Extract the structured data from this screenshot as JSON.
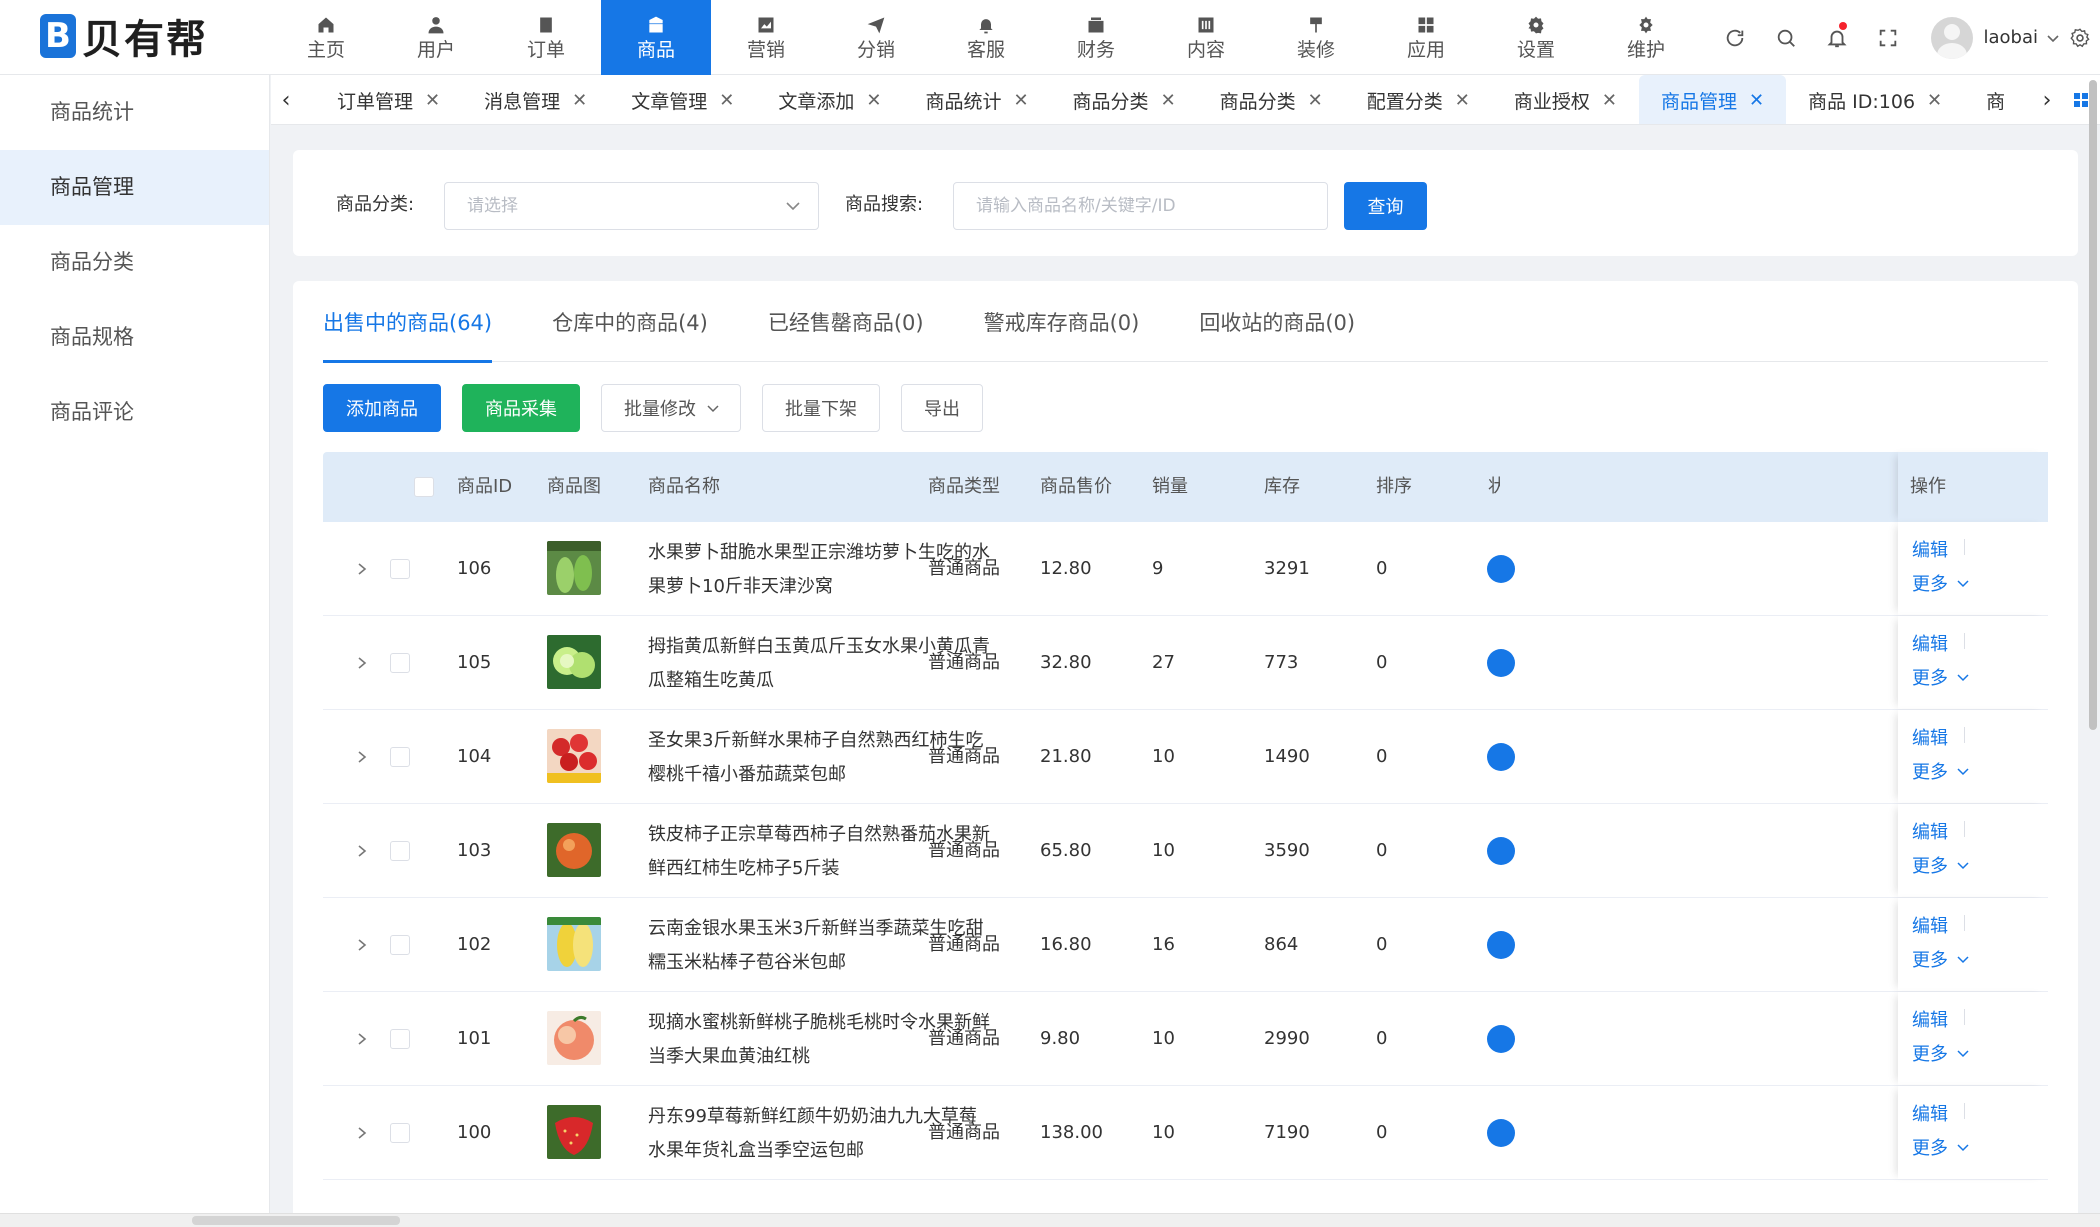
{
  "brand": {
    "logo_letter": "B",
    "name": "贝有帮",
    "color": "#1677e6"
  },
  "nav": [
    {
      "label": "主页",
      "icon": "home-icon",
      "active": false
    },
    {
      "label": "用户",
      "icon": "user-icon",
      "active": false
    },
    {
      "label": "订单",
      "icon": "order-icon",
      "active": false
    },
    {
      "label": "商品",
      "icon": "product-icon",
      "active": true
    },
    {
      "label": "营销",
      "icon": "marketing-icon",
      "active": false
    },
    {
      "label": "分销",
      "icon": "distribution-icon",
      "active": false
    },
    {
      "label": "客服",
      "icon": "service-icon",
      "active": false
    },
    {
      "label": "财务",
      "icon": "finance-icon",
      "active": false
    },
    {
      "label": "内容",
      "icon": "content-icon",
      "active": false
    },
    {
      "label": "装修",
      "icon": "decoration-icon",
      "active": false
    },
    {
      "label": "应用",
      "icon": "apps-icon",
      "active": false
    },
    {
      "label": "设置",
      "icon": "settings-icon",
      "active": false
    },
    {
      "label": "维护",
      "icon": "maintenance-icon",
      "active": false
    }
  ],
  "header_right": {
    "username": "laobai",
    "tools": [
      "refresh-icon",
      "search-icon",
      "bell-icon",
      "fullscreen-icon"
    ],
    "notification_dot": true
  },
  "sidebar": {
    "items": [
      {
        "label": "商品统计",
        "active": false
      },
      {
        "label": "商品管理",
        "active": true
      },
      {
        "label": "商品分类",
        "active": false
      },
      {
        "label": "商品规格",
        "active": false
      },
      {
        "label": "商品评论",
        "active": false
      }
    ]
  },
  "tabs": [
    {
      "label": "订单管理",
      "active": false
    },
    {
      "label": "消息管理",
      "active": false
    },
    {
      "label": "文章管理",
      "active": false
    },
    {
      "label": "文章添加",
      "active": false
    },
    {
      "label": "商品统计",
      "active": false
    },
    {
      "label": "商品分类",
      "active": false
    },
    {
      "label": "商品分类",
      "active": false
    },
    {
      "label": "配置分类",
      "active": false
    },
    {
      "label": "商业授权",
      "active": false
    },
    {
      "label": "商品管理",
      "active": true
    },
    {
      "label": "商品 ID:106",
      "active": false
    },
    {
      "label": "商",
      "active": false
    }
  ],
  "filter": {
    "category_label": "商品分类:",
    "category_placeholder": "请选择",
    "search_label": "商品搜索:",
    "search_placeholder": "请输入商品名称/关键字/ID",
    "query_button": "查询"
  },
  "status_tabs": [
    {
      "label": "出售中的商品(64)",
      "active": true
    },
    {
      "label": "仓库中的商品(4)",
      "active": false
    },
    {
      "label": "已经售罄商品(0)",
      "active": false
    },
    {
      "label": "警戒库存商品(0)",
      "active": false
    },
    {
      "label": "回收站的商品(0)",
      "active": false
    }
  ],
  "actions": {
    "add": "添加商品",
    "collect": "商品采集",
    "batch_edit": "批量修改",
    "batch_off": "批量下架",
    "export": "导出"
  },
  "table": {
    "headers": {
      "id": "商品ID",
      "image": "商品图",
      "name": "商品名称",
      "type": "商品类型",
      "price": "商品售价",
      "sales": "销量",
      "stock": "库存",
      "sort": "排序",
      "status_peek": "状",
      "ops": "操作"
    },
    "op_edit": "编辑",
    "op_more": "更多",
    "rows": [
      {
        "id": "106",
        "name": "水果萝卜甜脆水果型正宗潍坊萝卜生吃的水果萝卜10斤非天津沙窝",
        "type": "普通商品",
        "price": "12.80",
        "sales": "9",
        "stock": "3291",
        "sort": "0",
        "thumb": "radish",
        "thumb_color": "#4d7a3a"
      },
      {
        "id": "105",
        "name": "拇指黄瓜新鲜白玉黄瓜斤玉女水果小黄瓜青瓜整箱生吃黄瓜",
        "type": "普通商品",
        "price": "32.80",
        "sales": "27",
        "stock": "773",
        "sort": "0",
        "thumb": "cucumber",
        "thumb_color": "#b8e07a"
      },
      {
        "id": "104",
        "name": "圣女果3斤新鲜水果柿子自然熟西红柿生吃樱桃千禧小番茄蔬菜包邮",
        "type": "普通商品",
        "price": "21.80",
        "sales": "10",
        "stock": "1490",
        "sort": "0",
        "thumb": "cherry-tomato",
        "thumb_color": "#d32a2a"
      },
      {
        "id": "103",
        "name": "铁皮柿子正宗草莓西柿子自然熟番茄水果新鲜西红柿生吃柿子5斤装",
        "type": "普通商品",
        "price": "65.80",
        "sales": "10",
        "stock": "3590",
        "sort": "0",
        "thumb": "tomato",
        "thumb_color": "#e0662a"
      },
      {
        "id": "102",
        "name": "云南金银水果玉米3斤新鲜当季蔬菜生吃甜糯玉米粘棒子苞谷米包邮",
        "type": "普通商品",
        "price": "16.80",
        "sales": "16",
        "stock": "864",
        "sort": "0",
        "thumb": "corn",
        "thumb_color": "#f0d23a"
      },
      {
        "id": "101",
        "name": "现摘水蜜桃新鲜桃子脆桃毛桃时令水果新鲜当季大果血黄油红桃",
        "type": "普通商品",
        "price": "9.80",
        "sales": "10",
        "stock": "2990",
        "sort": "0",
        "thumb": "peach",
        "thumb_color": "#f07a6a"
      },
      {
        "id": "100",
        "name": "丹东99草莓新鲜红颜牛奶奶油九九大草莓水果年货礼盒当季空运包邮",
        "type": "普通商品",
        "price": "138.00",
        "sales": "10",
        "stock": "7190",
        "sort": "0",
        "thumb": "strawberry",
        "thumb_color": "#d8282a"
      }
    ]
  }
}
